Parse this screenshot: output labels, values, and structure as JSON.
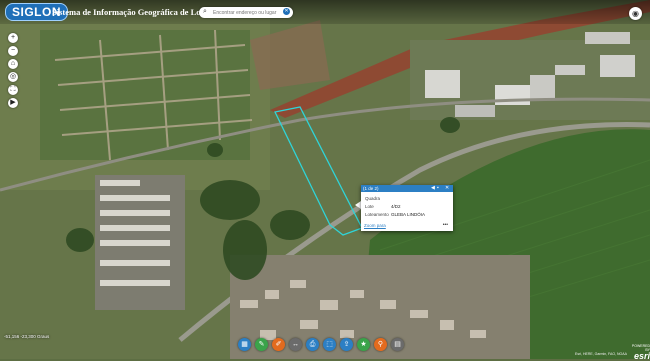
{
  "header": {
    "logo_text": "SIGLON",
    "app_title": "Sistema de Informação Geográfica de Londrina",
    "search_placeholder": "Encontrar endereço ou lugar"
  },
  "icons": {
    "search": "search-icon",
    "clear": "close-icon",
    "visibility": "eye-icon",
    "zoom_in": "plus-icon",
    "zoom_out": "minus-icon",
    "home": "home-icon",
    "locate": "locate-icon",
    "fullscreen": "fullscreen-icon",
    "layers": "layers-icon"
  },
  "popup": {
    "counter": "(1 de 2)",
    "fields": [
      {
        "label": "Quadra",
        "value": ""
      },
      {
        "label": "Lote",
        "value": "4/D2"
      },
      {
        "label": "Loteamento",
        "value": "GLEBA LINDÓIA"
      }
    ],
    "zoom_label": "Zoom para",
    "more_label": "•••"
  },
  "bottom_tools": [
    {
      "icon": "basemap-icon",
      "color": "#2c7fc4"
    },
    {
      "icon": "edit-icon",
      "color": "#3aa34a"
    },
    {
      "icon": "draw-icon",
      "color": "#e36b1e"
    },
    {
      "icon": "measure-icon",
      "color": "#6b6b6b"
    },
    {
      "icon": "print-icon",
      "color": "#2c7fc4"
    },
    {
      "icon": "select-icon",
      "color": "#2c7fc4"
    },
    {
      "icon": "share-icon",
      "color": "#2c7fc4"
    },
    {
      "icon": "bookmark-icon",
      "color": "#3aa34a"
    },
    {
      "icon": "query-icon",
      "color": "#e36b1e"
    },
    {
      "icon": "gallery-icon",
      "color": "#6b6b6b"
    }
  ],
  "status": {
    "coordinates": "-51,156 -23,300 Graus",
    "attribution": "Esri, HERE, Garmin, FAO, NOAA",
    "esri_powered": "POWERED BY",
    "esri_brand": "esri"
  },
  "colors": {
    "accent": "#2c7fc4",
    "parcel_outline": "#2fd4d8"
  }
}
